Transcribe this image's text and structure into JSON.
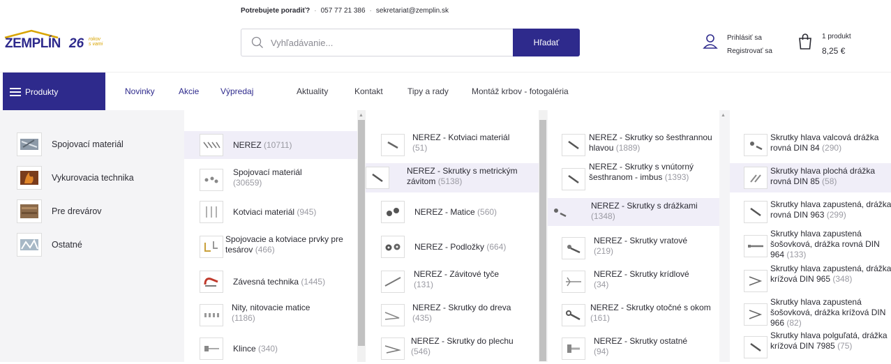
{
  "topbar": {
    "help": "Potrebujete poradiť?",
    "phone": "057 77 21 386",
    "email": "sekretariat@zemplin.sk"
  },
  "logo": {
    "name": "ZEMPLÍN",
    "number": "26",
    "tagline1": "rokov",
    "tagline2": "s vami"
  },
  "search": {
    "placeholder": "Vyhľadávanie...",
    "button": "Hľadať"
  },
  "account": {
    "login": "Prihlásiť sa",
    "register": "Registrovať sa"
  },
  "cart": {
    "count": "1 produkt",
    "price": "8,25 €"
  },
  "nav": {
    "products": "Produkty",
    "links": [
      "Novinky",
      "Akcie",
      "Výpredaj"
    ],
    "links2": [
      "Aktuality",
      "Kontakt",
      "Tipy a rady",
      "Montáž krbov - fotogaléria"
    ]
  },
  "side": [
    {
      "label": "Spojovací materiál"
    },
    {
      "label": "Vykurovacia technika"
    },
    {
      "label": "Pre drevárov"
    },
    {
      "label": "Ostatné"
    }
  ],
  "col1": [
    {
      "label": "NEREZ",
      "count": "(10711)"
    },
    {
      "label": "Spojovací materiál",
      "count": "(30659)"
    },
    {
      "label": "Kotviaci materiál",
      "count": "(945)"
    },
    {
      "label": "Spojovacie a kotviace prvky pre tesárov",
      "count": "(466)"
    },
    {
      "label": "Závesná technika",
      "count": "(1445)"
    },
    {
      "label": "Nity, nitovacie matice",
      "count": "(1186)"
    },
    {
      "label": "Klince",
      "count": "(340)"
    }
  ],
  "col2": [
    {
      "label": "NEREZ - Kotviaci materiál",
      "count": "(51)"
    },
    {
      "label": "NEREZ - Skrutky s metrickým závitom",
      "count": "(5138)"
    },
    {
      "label": "NEREZ - Matice",
      "count": "(560)"
    },
    {
      "label": "NEREZ - Podložky",
      "count": "(664)"
    },
    {
      "label": "NEREZ - Závitové tyče",
      "count": "(131)"
    },
    {
      "label": "NEREZ - Skrutky do dreva",
      "count": "(435)"
    },
    {
      "label": "NEREZ - Skrutky do plechu",
      "count": "(546)"
    }
  ],
  "col3": [
    {
      "label": "NEREZ - Skrutky so šesthrannou hlavou",
      "count": "(1889)"
    },
    {
      "label": "NEREZ - Skrutky s vnútorný šesthranom - imbus",
      "count": "(1393)"
    },
    {
      "label": "NEREZ - Skrutky s drážkami",
      "count": "(1348)"
    },
    {
      "label": "NEREZ - Skrutky vratové",
      "count": "(219)"
    },
    {
      "label": "NEREZ - Skrutky krídlové",
      "count": "(34)"
    },
    {
      "label": "NEREZ - Skrutky otočné s okom",
      "count": "(161)"
    },
    {
      "label": "NEREZ - Skrutky ostatné",
      "count": "(94)"
    }
  ],
  "col4": [
    {
      "label": "Skrutky hlava valcová drážka rovná DIN 84",
      "count": "(290)"
    },
    {
      "label": "Skrutky hlava plochá drážka rovná DIN 85",
      "count": "(58)"
    },
    {
      "label": "Skrutky hlava zapustená, drážka rovná DIN 963",
      "count": "(299)"
    },
    {
      "label": "Skrutky hlava zapustená šošovková, drážka rovná DIN 964",
      "count": "(133)"
    },
    {
      "label": "Skrutky hlava zapustená, drážka krížová DIN 965",
      "count": "(348)"
    },
    {
      "label": "Skrutky hlava zapustená šošovková, drážka krížová DIN 966",
      "count": "(82)"
    },
    {
      "label": "Skrutky hlava polguľatá, drážka krížová DIN 7985",
      "count": "(75)"
    }
  ],
  "colors": {
    "brand": "#2e2a8c",
    "accent": "#d8a400",
    "active_row": "#f0eef8"
  }
}
